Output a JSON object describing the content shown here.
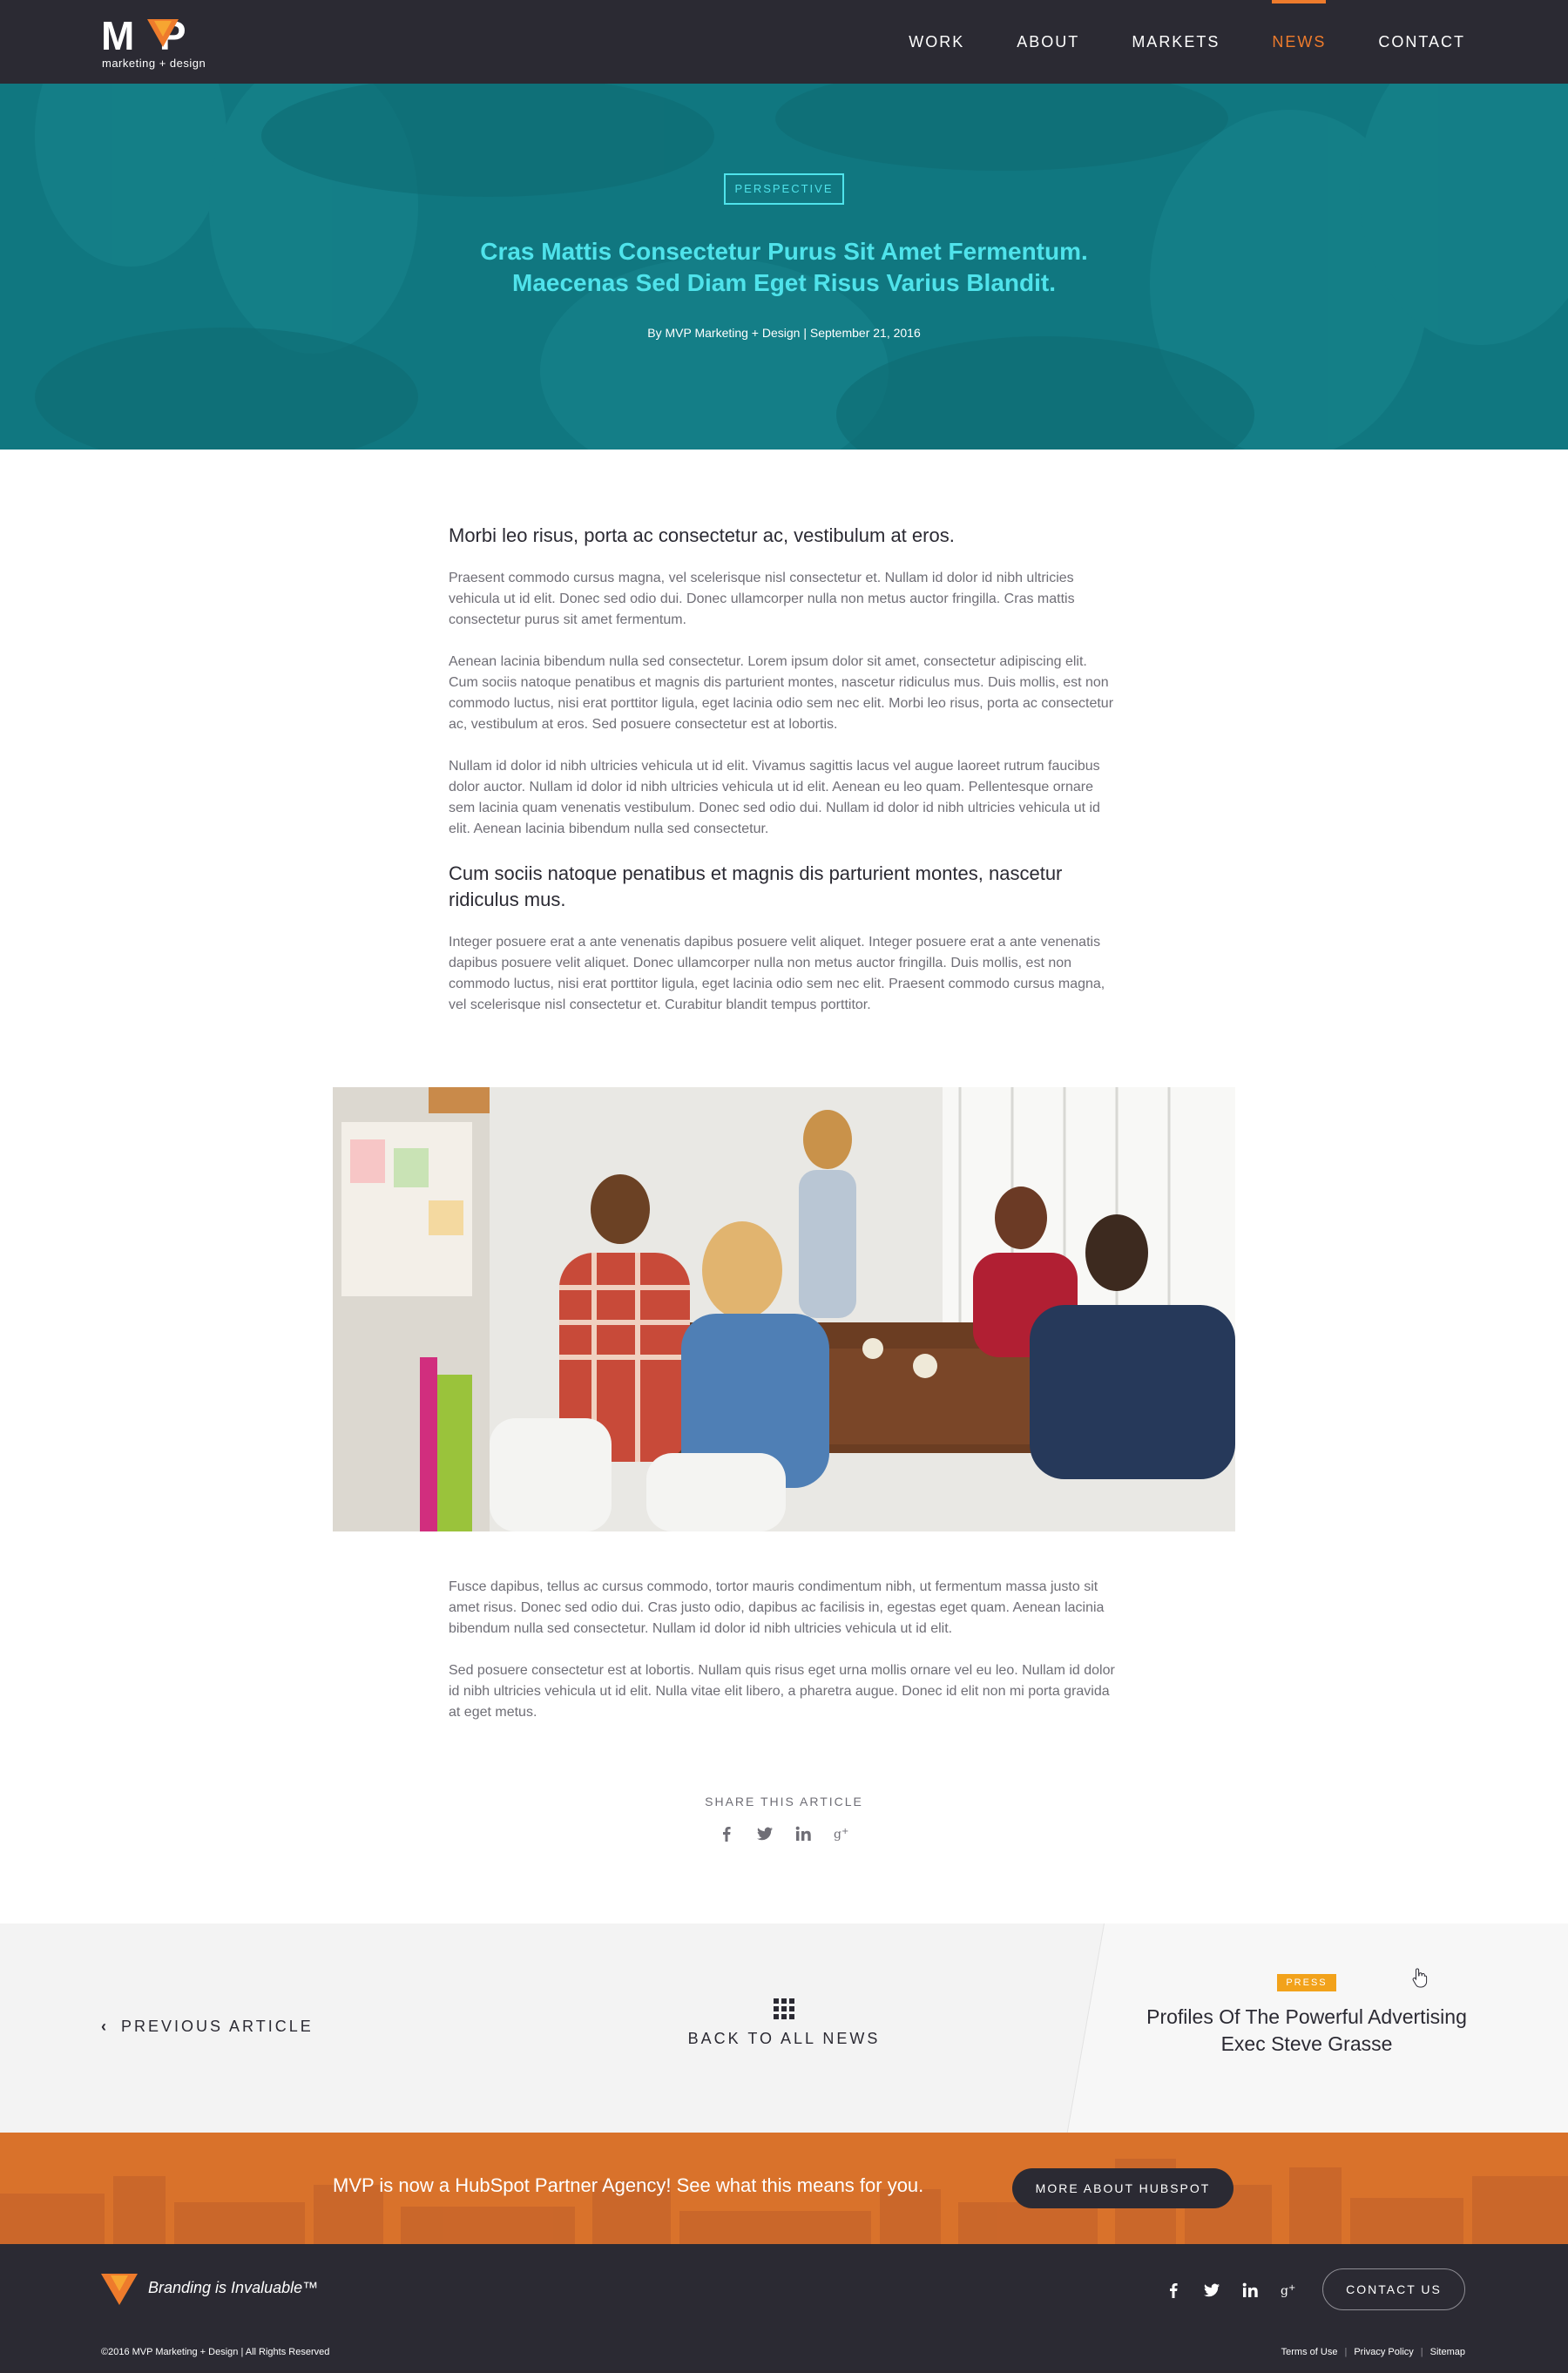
{
  "nav": {
    "logo_word": "MVP",
    "logo_sub": "marketing + design",
    "links": [
      {
        "label": "WORK"
      },
      {
        "label": "ABOUT"
      },
      {
        "label": "MARKETS"
      },
      {
        "label": "NEWS"
      },
      {
        "label": "CONTACT"
      }
    ],
    "active": "NEWS"
  },
  "hero": {
    "tag": "PERSPECTIVE",
    "title_line1": "Cras Mattis Consectetur Purus Sit Amet Fermentum.",
    "title_line2": "Maecenas Sed Diam Eget Risus Varius Blandit.",
    "byline": "By MVP Marketing + Design | September 21, 2016"
  },
  "article": {
    "heading1": "Morbi leo risus, porta ac consectetur ac, vestibulum at eros.",
    "p1": "Praesent commodo cursus magna, vel scelerisque nisl consectetur et. Nullam id dolor id nibh ultricies vehicula ut id elit. Donec sed odio dui. Donec ullamcorper nulla non metus auctor fringilla. Cras mattis consectetur purus sit amet fermentum.",
    "p2": "Aenean lacinia bibendum nulla sed consectetur. Lorem ipsum dolor sit amet, consectetur adipiscing elit. Cum sociis natoque penatibus et magnis dis parturient montes, nascetur ridiculus mus. Duis mollis, est non commodo luctus, nisi erat porttitor ligula, eget lacinia odio sem nec elit. Morbi leo risus, porta ac consectetur ac, vestibulum at eros. Sed posuere consectetur est at lobortis.",
    "p3": "Nullam id dolor id nibh ultricies vehicula ut id elit. Vivamus sagittis lacus vel augue laoreet rutrum faucibus dolor auctor. Nullam id dolor id nibh ultricies vehicula ut id elit. Aenean eu leo quam. Pellentesque ornare sem lacinia quam venenatis vestibulum. Donec sed odio dui. Nullam id dolor id nibh ultricies vehicula ut id elit. Aenean lacinia bibendum nulla sed consectetur.",
    "heading2": "Cum sociis natoque penatibus et magnis dis parturient montes, nascetur ridiculus mus.",
    "p4": "Integer posuere erat a ante venenatis dapibus posuere velit aliquet. Integer posuere erat a ante venenatis dapibus posuere velit aliquet. Donec ullamcorper nulla non metus auctor fringilla. Duis mollis, est non commodo luctus, nisi erat porttitor ligula, eget lacinia odio sem nec elit. Praesent commodo cursus magna, vel scelerisque nisl consectetur et. Curabitur blandit tempus porttitor.",
    "p5": "Fusce dapibus, tellus ac cursus commodo, tortor mauris condimentum nibh, ut fermentum massa justo sit amet risus. Donec sed odio dui. Cras justo odio, dapibus ac facilisis in, egestas eget quam. Aenean lacinia bibendum nulla sed consectetur. Nullam id dolor id nibh ultricies vehicula ut id elit.",
    "p6": "Sed posuere consectetur est at lobortis. Nullam quis risus eget urna mollis ornare vel eu leo. Nullam id dolor id nibh ultricies vehicula ut id elit. Nulla vitae elit libero, a pharetra augue. Donec id elit non mi porta gravida at eget metus."
  },
  "share": {
    "label": "SHARE THIS ARTICLE",
    "icons": [
      "facebook-icon",
      "twitter-icon",
      "linkedin-icon",
      "google-plus-icon"
    ]
  },
  "pager": {
    "prev_label": "PREVIOUS ARTICLE",
    "back_label": "BACK TO ALL NEWS",
    "next_tag": "PRESS",
    "next_title": "Profiles Of The Powerful Advertising Exec Steve Grasse"
  },
  "promo": {
    "text": "MVP is now a HubSpot Partner Agency! See what this means for you.",
    "button": "MORE ABOUT HUBSPOT"
  },
  "footer": {
    "tagline": "Branding is Invaluable™",
    "contact_button": "CONTACT US",
    "copyright": "©2016 MVP Marketing + Design | All Rights Reserved",
    "legal": [
      "Terms of Use",
      "Privacy Policy",
      "Sitemap"
    ]
  },
  "colors": {
    "nav_bg": "#2b2a33",
    "accent_orange": "#ee7b2c",
    "hero_teal": "#127b84",
    "hero_text": "#4fe3eb",
    "press_yellow": "#f2a21b",
    "promo_orange": "#d9722b"
  }
}
